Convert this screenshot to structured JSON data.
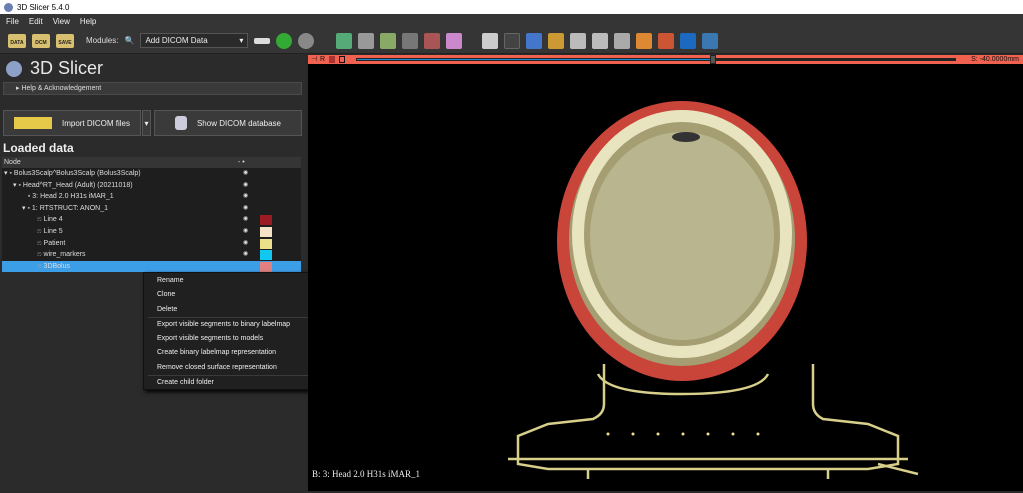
{
  "window": {
    "title": "3D Slicer 5.4.0"
  },
  "menu": [
    "File",
    "Edit",
    "View",
    "Help"
  ],
  "toolbar": {
    "modules_label": "Modules:",
    "module_selected": "Add DICOM Data",
    "tools": [
      "DATA",
      "DCM",
      "SAVE"
    ]
  },
  "panel": {
    "brand": "3D Slicer",
    "help": "Help & Acknowledgement",
    "import_button": "Import DICOM files",
    "show_button": "Show DICOM database",
    "loaded_heading": "Loaded data",
    "node_col": "Node"
  },
  "tree": [
    {
      "label": "Bolus3Scalp^Bolus3Scalp (Bolus3Scalp)",
      "indent": 0,
      "arrow": "▾"
    },
    {
      "label": "Head^RT_Head (Adult) (20211018)",
      "indent": 1,
      "arrow": "▾"
    },
    {
      "label": "3: Head  2.0  H31s  iMAR_1",
      "indent": 2,
      "arrow": ""
    },
    {
      "label": "1: RTSTRUCT: ANON_1",
      "indent": 2,
      "arrow": "▾"
    },
    {
      "label": "Line 4",
      "indent": 3,
      "arrow": "",
      "color": "#9b1b24"
    },
    {
      "label": "Line 5",
      "indent": 3,
      "arrow": "",
      "color": "#f6e3c6"
    },
    {
      "label": "Patient",
      "indent": 3,
      "arrow": "",
      "color": "#ece08a"
    },
    {
      "label": "wire_markers",
      "indent": 3,
      "arrow": "",
      "color": "#12c8f0"
    },
    {
      "label": "3DBolus",
      "indent": 3,
      "arrow": "",
      "color": "#e08080",
      "selected": true
    }
  ],
  "context_menu": [
    "Rename",
    "Clone",
    "Delete",
    "Export visible segments to binary labelmap",
    "Export visible segments to models",
    "Create binary labelmap representation",
    "Remove closed surface representation",
    "Create child folder"
  ],
  "viewer": {
    "slice_label": "R",
    "offset": "S: -40.0000mm",
    "slider_fraction": 0.6,
    "corner_text": "B: 3: Head  2.0  H31s  iMAR_1",
    "bar_color": "#f0614f"
  }
}
